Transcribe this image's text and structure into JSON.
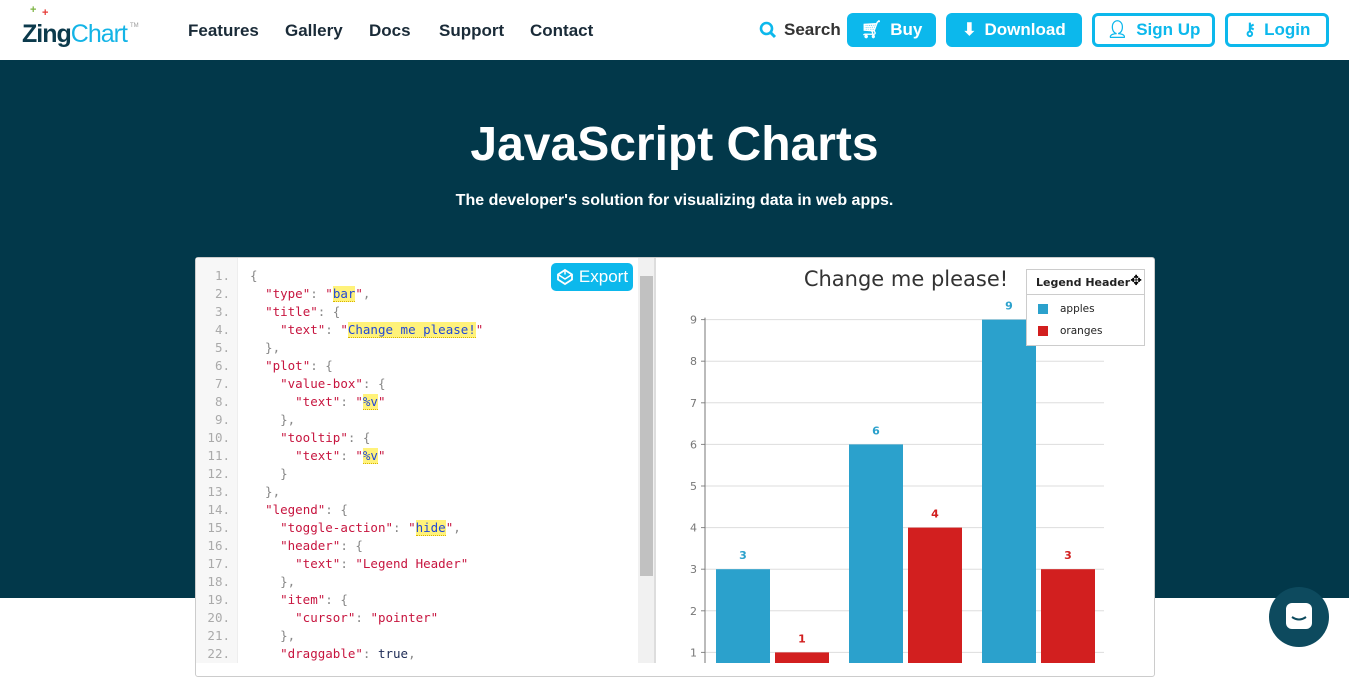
{
  "nav": {
    "logo": "ZingChart",
    "items": [
      "Features",
      "Gallery",
      "Docs",
      "Support",
      "Contact"
    ],
    "search": "Search",
    "buy": "Buy",
    "download": "Download",
    "signup": "Sign Up",
    "login": "Login"
  },
  "hero": {
    "title": "JavaScript Charts",
    "subtitle": "The developer's solution for visualizing data in web apps."
  },
  "editor": {
    "export": "Export",
    "lines": [
      [
        [
          "p",
          "{"
        ]
      ],
      [
        [
          "p",
          "  "
        ],
        [
          "k",
          "\"type\""
        ],
        [
          "p",
          ": "
        ],
        [
          "s",
          "\""
        ],
        [
          "h",
          "bar"
        ],
        [
          "s",
          "\""
        ],
        [
          "p",
          ","
        ]
      ],
      [
        [
          "p",
          "  "
        ],
        [
          "k",
          "\"title\""
        ],
        [
          "p",
          ": {"
        ]
      ],
      [
        [
          "p",
          "    "
        ],
        [
          "k",
          "\"text\""
        ],
        [
          "p",
          ": "
        ],
        [
          "s",
          "\""
        ],
        [
          "h",
          "Change me please!"
        ],
        [
          "s",
          "\""
        ]
      ],
      [
        [
          "p",
          "  },"
        ]
      ],
      [
        [
          "p",
          "  "
        ],
        [
          "k",
          "\"plot\""
        ],
        [
          "p",
          ": {"
        ]
      ],
      [
        [
          "p",
          "    "
        ],
        [
          "k",
          "\"value-box\""
        ],
        [
          "p",
          ": {"
        ]
      ],
      [
        [
          "p",
          "      "
        ],
        [
          "k",
          "\"text\""
        ],
        [
          "p",
          ": "
        ],
        [
          "s",
          "\""
        ],
        [
          "h",
          "%v"
        ],
        [
          "s",
          "\""
        ]
      ],
      [
        [
          "p",
          "    },"
        ]
      ],
      [
        [
          "p",
          "    "
        ],
        [
          "k",
          "\"tooltip\""
        ],
        [
          "p",
          ": {"
        ]
      ],
      [
        [
          "p",
          "      "
        ],
        [
          "k",
          "\"text\""
        ],
        [
          "p",
          ": "
        ],
        [
          "s",
          "\""
        ],
        [
          "h",
          "%v"
        ],
        [
          "s",
          "\""
        ]
      ],
      [
        [
          "p",
          "    }"
        ]
      ],
      [
        [
          "p",
          "  },"
        ]
      ],
      [
        [
          "p",
          "  "
        ],
        [
          "k",
          "\"legend\""
        ],
        [
          "p",
          ": {"
        ]
      ],
      [
        [
          "p",
          "    "
        ],
        [
          "k",
          "\"toggle-action\""
        ],
        [
          "p",
          ": "
        ],
        [
          "s",
          "\""
        ],
        [
          "h",
          "hide"
        ],
        [
          "s",
          "\""
        ],
        [
          "p",
          ","
        ]
      ],
      [
        [
          "p",
          "    "
        ],
        [
          "k",
          "\"header\""
        ],
        [
          "p",
          ": {"
        ]
      ],
      [
        [
          "p",
          "      "
        ],
        [
          "k",
          "\"text\""
        ],
        [
          "p",
          ": "
        ],
        [
          "s",
          "\"Legend Header\""
        ]
      ],
      [
        [
          "p",
          "    },"
        ]
      ],
      [
        [
          "p",
          "    "
        ],
        [
          "k",
          "\"item\""
        ],
        [
          "p",
          ": {"
        ]
      ],
      [
        [
          "p",
          "      "
        ],
        [
          "k",
          "\"cursor\""
        ],
        [
          "p",
          ": "
        ],
        [
          "s",
          "\"pointer\""
        ]
      ],
      [
        [
          "p",
          "    },"
        ]
      ],
      [
        [
          "p",
          "    "
        ],
        [
          "k",
          "\"draggable\""
        ],
        [
          "p",
          ": "
        ],
        [
          "b",
          "true"
        ],
        [
          "p",
          ","
        ]
      ]
    ]
  },
  "chart_data": {
    "type": "bar",
    "title": "Change me please!",
    "categories": [
      "",
      "",
      ""
    ],
    "series": [
      {
        "name": "apples",
        "values": [
          3,
          6,
          9
        ],
        "color": "#2ba1cc"
      },
      {
        "name": "oranges",
        "values": [
          1,
          4,
          3
        ],
        "color": "#d21f1f"
      }
    ],
    "yticks": [
      1,
      2,
      3,
      4,
      5,
      6,
      7,
      8,
      9
    ],
    "ylim": [
      0,
      9
    ],
    "grid": true,
    "legend": {
      "header": "Legend Header",
      "placement": "top-right"
    }
  },
  "colors": {
    "hero_bg": "#02384a",
    "accent": "#0cb8ec"
  }
}
